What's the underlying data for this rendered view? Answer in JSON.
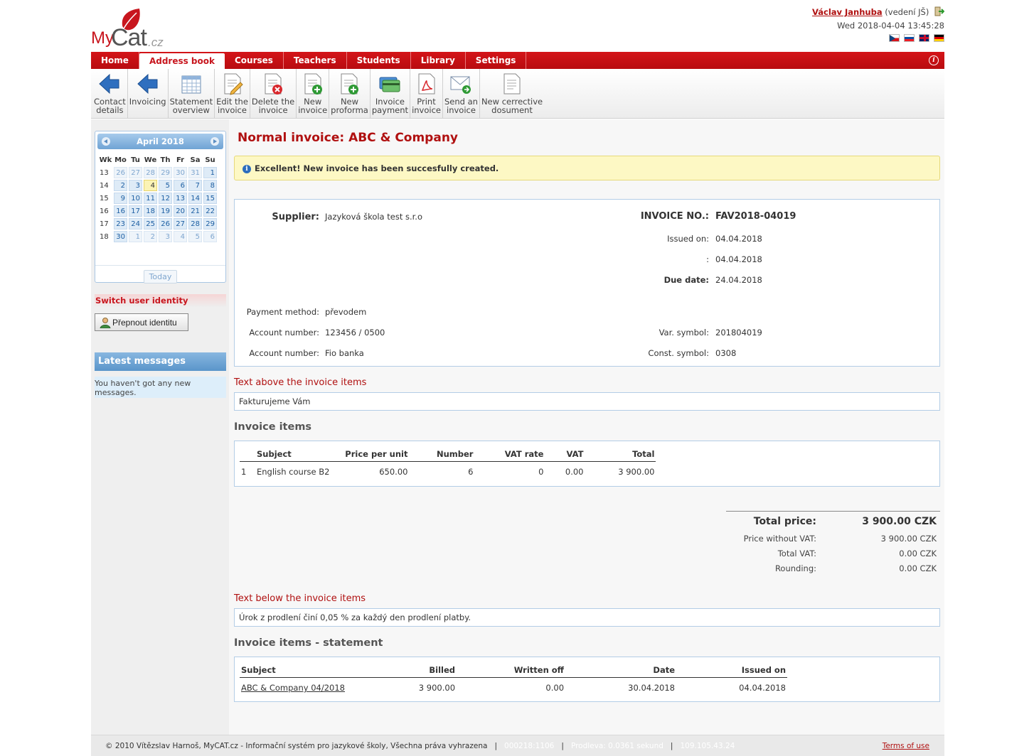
{
  "header": {
    "logo": {
      "my": "My",
      "cat": "Cat",
      "cz": ".cz"
    },
    "user": {
      "name": "Václav Janhuba",
      "role": "(vedení JŠ)",
      "datetime": "Wed 2018-04-04 13:45:28"
    },
    "languages": [
      "cz",
      "sk",
      "en",
      "de"
    ]
  },
  "nav": {
    "items": [
      {
        "label": "Home"
      },
      {
        "label": "Address book",
        "active": true
      },
      {
        "label": "Courses"
      },
      {
        "label": "Teachers"
      },
      {
        "label": "Students"
      },
      {
        "label": "Library"
      },
      {
        "label": "Settings"
      }
    ],
    "info_icon": "i"
  },
  "toolbar": {
    "items": [
      {
        "label": "Contact\ndetails",
        "icon": "back-arrow-icon"
      },
      {
        "label": "Invoicing",
        "icon": "back-arrow-icon"
      },
      {
        "label": "Statement\noverview",
        "icon": "spreadsheet-icon"
      },
      {
        "label": "Edit the\ninvoice",
        "icon": "edit-document-icon"
      },
      {
        "label": "Delete the\ninvoice",
        "icon": "delete-document-icon"
      },
      {
        "label": "New\ninvoice",
        "icon": "add-document-icon"
      },
      {
        "label": "New\nproforma",
        "icon": "add-document-icon"
      },
      {
        "label": "Invoice\npayment",
        "icon": "payment-card-icon"
      },
      {
        "label": "Print\ninvoice",
        "icon": "pdf-icon"
      },
      {
        "label": "Send an\ninvoice",
        "icon": "send-mail-icon"
      },
      {
        "label": "New cerrective\ndosument",
        "icon": "document-icon"
      }
    ]
  },
  "calendar": {
    "month": "April 2018",
    "weekdays": [
      "Wk",
      "Mo",
      "Tu",
      "We",
      "Th",
      "Fr",
      "Sa",
      "Su"
    ],
    "weeks": [
      {
        "wk": "13",
        "days": [
          "26",
          "27",
          "28",
          "29",
          "30",
          "31",
          "1"
        ]
      },
      {
        "wk": "14",
        "days": [
          "2",
          "3",
          "4",
          "5",
          "6",
          "7",
          "8"
        ]
      },
      {
        "wk": "15",
        "days": [
          "9",
          "10",
          "11",
          "12",
          "13",
          "14",
          "15"
        ]
      },
      {
        "wk": "16",
        "days": [
          "16",
          "17",
          "18",
          "19",
          "20",
          "21",
          "22"
        ]
      },
      {
        "wk": "17",
        "days": [
          "23",
          "24",
          "25",
          "26",
          "27",
          "28",
          "29"
        ]
      },
      {
        "wk": "18",
        "days": [
          "30",
          "1",
          "2",
          "3",
          "4",
          "5",
          "6"
        ]
      }
    ],
    "today_label": "Today",
    "today_day": "4"
  },
  "sidebar": {
    "switch_title": "Switch user identity",
    "switch_button": "Přepnout identitu",
    "messages_title": "Latest messages",
    "messages_text": "You haven't got any new messages."
  },
  "invoice": {
    "page_title": "Normal invoice: ABC & Company",
    "notice": "Excellent! New invoice has been succesfully created.",
    "supplier_label": "Supplier:",
    "supplier": "Jazyková škola test s.r.o",
    "number_label": "INVOICE NO.:",
    "number": "FAV2018-04019",
    "issued_label": "Issued on:",
    "issued": "04.04.2018",
    "blank_label": ":",
    "blank_value": "04.04.2018",
    "due_label": "Due date:",
    "due": "24.04.2018",
    "payment_method_label": "Payment method:",
    "payment_method": "převodem",
    "account_label": "Account number:",
    "account": "123456 / 0500",
    "bank_label": "Account number:",
    "bank": "Fio banka",
    "var_symbol_label": "Var. symbol:",
    "var_symbol": "201804019",
    "const_symbol_label": "Const. symbol:",
    "const_symbol": "0308",
    "text_above_title": "Text above the invoice items",
    "text_above": "Fakturujeme Vám",
    "items_title": "Invoice items",
    "items_columns": [
      "",
      "Subject",
      "Price per unit",
      "Number",
      "VAT rate",
      "VAT",
      "Total"
    ],
    "items": [
      {
        "no": "1",
        "subject": "English course B2",
        "price": "650.00",
        "number": "6",
        "vat_rate": "0",
        "vat": "0.00",
        "total": "3 900.00"
      }
    ],
    "totals": {
      "total_label": "Total price:",
      "total": "3 900.00 CZK",
      "without_vat_label": "Price without VAT:",
      "without_vat": "3 900.00 CZK",
      "vat_label": "Total VAT:",
      "vat": "0.00 CZK",
      "rounding_label": "Rounding:",
      "rounding": "0.00 CZK"
    },
    "text_below_title": "Text below the invoice items",
    "text_below": "Úrok z prodlení činí 0,05 % za každý den prodlení platby.",
    "statement_title": "Invoice items - statement",
    "statement_columns": [
      "Subject",
      "Billed",
      "Written off",
      "Date",
      "Issued on"
    ],
    "statement": [
      {
        "subject": "ABC & Company 04/2018",
        "billed": "3 900.00",
        "written_off": "0.00",
        "date": "30.04.2018",
        "issued": "04.04.2018"
      }
    ]
  },
  "footer": {
    "copyright": "© 2010 Vítězslav Harnoš, MyCAT.cz - Informační systém pro jazykové školy, Všechna práva vyhrazena",
    "sep": "|",
    "code": "000218:1106",
    "delay": "Prodleva: 0.0361 sekund",
    "ip": "109.105.43.24",
    "terms": "Terms of use"
  },
  "colors": {
    "brand_red": "#c8161e",
    "link_blue": "#1d5fa3",
    "notice_yellow": "#fdf8c4",
    "panel_border": "#b3cde6"
  }
}
